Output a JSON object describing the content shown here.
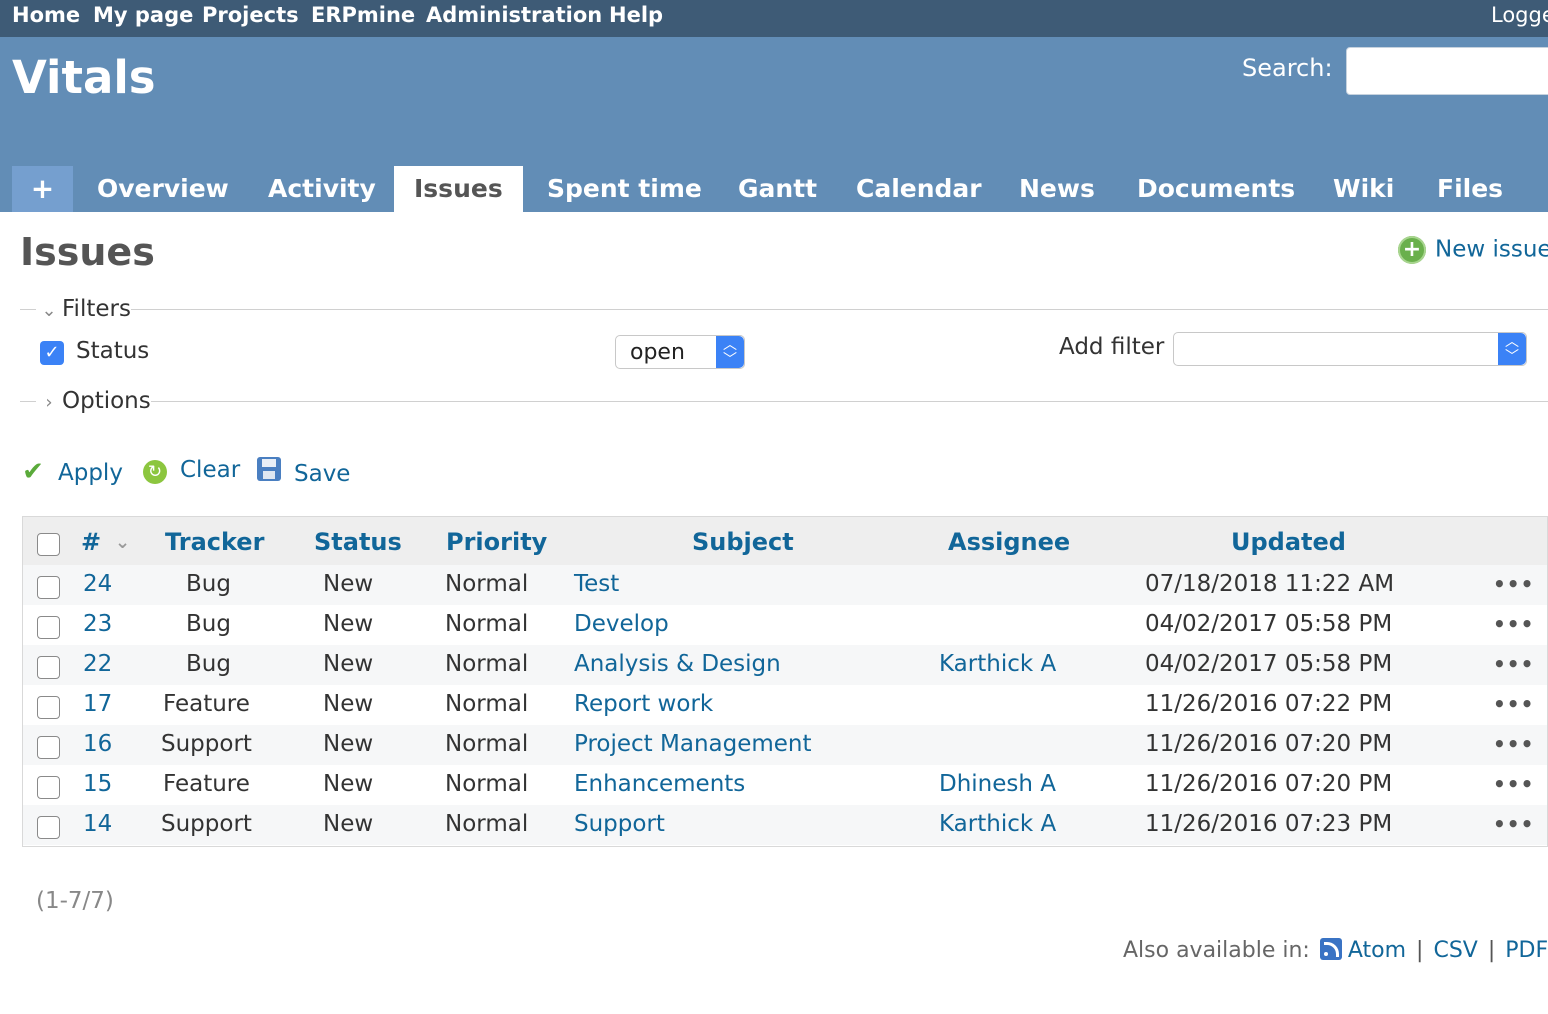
{
  "top_menu": {
    "items": [
      "Home",
      "My page",
      "Projects",
      "ERPmine",
      "Administration",
      "Help"
    ],
    "logged": "Logge"
  },
  "header": {
    "project_title": "Vitals",
    "search_label": "Search:",
    "search_value": ""
  },
  "tabs": {
    "plus": "+",
    "items": [
      "Overview",
      "Activity",
      "Issues",
      "Spent time",
      "Gantt",
      "Calendar",
      "News",
      "Documents",
      "Wiki",
      "Files"
    ],
    "selected": "Issues"
  },
  "content": {
    "title": "Issues",
    "new_issue": "New issue"
  },
  "filters": {
    "legend": "Filters",
    "status_label": "Status",
    "status_checked": true,
    "status_operator": "open",
    "add_filter_label": "Add filter",
    "add_filter_value": ""
  },
  "options": {
    "legend": "Options"
  },
  "actions": {
    "apply": "Apply",
    "clear": "Clear",
    "save": "Save"
  },
  "table": {
    "headers": {
      "id": "#",
      "tracker": "Tracker",
      "status": "Status",
      "priority": "Priority",
      "subject": "Subject",
      "assignee": "Assignee",
      "updated": "Updated"
    },
    "rows": [
      {
        "id": "24",
        "tracker": "Bug",
        "status": "New",
        "priority": "Normal",
        "subject": "Test",
        "assignee": "",
        "updated": "07/18/2018 11:22 AM"
      },
      {
        "id": "23",
        "tracker": "Bug",
        "status": "New",
        "priority": "Normal",
        "subject": "Develop",
        "assignee": "",
        "updated": "04/02/2017 05:58 PM"
      },
      {
        "id": "22",
        "tracker": "Bug",
        "status": "New",
        "priority": "Normal",
        "subject": "Analysis & Design",
        "assignee": "Karthick A",
        "updated": "04/02/2017 05:58 PM"
      },
      {
        "id": "17",
        "tracker": "Feature",
        "status": "New",
        "priority": "Normal",
        "subject": "Report work",
        "assignee": "",
        "updated": "11/26/2016 07:22 PM"
      },
      {
        "id": "16",
        "tracker": "Support",
        "status": "New",
        "priority": "Normal",
        "subject": "Project Management",
        "assignee": "",
        "updated": "11/26/2016 07:20 PM"
      },
      {
        "id": "15",
        "tracker": "Feature",
        "status": "New",
        "priority": "Normal",
        "subject": "Enhancements",
        "assignee": "Dhinesh A",
        "updated": "11/26/2016 07:20 PM"
      },
      {
        "id": "14",
        "tracker": "Support",
        "status": "New",
        "priority": "Normal",
        "subject": "Support",
        "assignee": "Karthick A",
        "updated": "11/26/2016 07:23 PM"
      }
    ],
    "row_menu": "•••"
  },
  "pagination": "(1-7/7)",
  "footer": {
    "also_available": "Also available in:",
    "formats": [
      "Atom",
      "CSV",
      "PDF"
    ],
    "separator": "|"
  },
  "colors": {
    "top_menu_bg": "#3e5b76",
    "header_bg": "#628db6",
    "link": "#116699",
    "accent_blue": "#3b82f6"
  }
}
